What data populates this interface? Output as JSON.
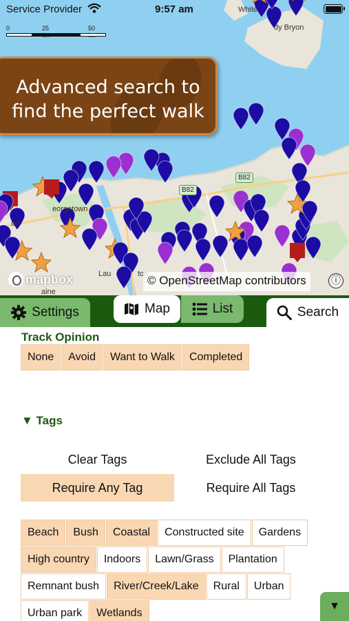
{
  "status_bar": {
    "carrier": "Service Provider",
    "time": "9:57 am",
    "wifi_icon": "wifi-icon",
    "battery_icon": "battery-icon"
  },
  "map": {
    "scale": {
      "labels": [
        "0",
        "25 km",
        "50 km"
      ]
    },
    "banner_line1": "Advanced search to",
    "banner_line2": "find the perfect walk",
    "place_labels": [
      "White",
      "dy Bryon",
      "eorgetown",
      "ort",
      "Lau",
      "ton",
      "aine"
    ],
    "road_badges": [
      "B82",
      "B82"
    ],
    "attribution": "© OpenStreetMap contributors",
    "mapbox_logo": "mapbox",
    "info_button": "ⓘ",
    "colors": {
      "water": "#8fd0f0",
      "land": "#e9e5da",
      "pin_blue": "#1c0ca3",
      "pin_purple": "#9a30d1",
      "pin_orange": "#f0a040"
    }
  },
  "tabs": {
    "settings": "Settings",
    "map": "Map",
    "list": "List",
    "search": "Search",
    "icons": {
      "settings": "gear-icon",
      "map": "map-icon",
      "list": "list-icon",
      "search": "magnifier-icon"
    }
  },
  "track_opinion": {
    "title": "Track Opinion",
    "options": [
      {
        "label": "None",
        "selected": true
      },
      {
        "label": "Avoid",
        "selected": true
      },
      {
        "label": "Want to Walk",
        "selected": true
      },
      {
        "label": "Completed",
        "selected": true
      }
    ]
  },
  "tags": {
    "title": "▼ Tags",
    "actions": {
      "clear": "Clear Tags",
      "exclude_all": "Exclude All Tags",
      "require_any": "Require Any Tag",
      "require_all": "Require All Tags"
    },
    "items": [
      {
        "label": "Beach",
        "selected": true
      },
      {
        "label": "Bush",
        "selected": true
      },
      {
        "label": "Coastal",
        "selected": true
      },
      {
        "label": "Constructed site",
        "selected": false
      },
      {
        "label": "Gardens",
        "selected": false
      },
      {
        "label": "High country",
        "selected": true
      },
      {
        "label": "Indoors",
        "selected": false
      },
      {
        "label": "Lawn/Grass",
        "selected": false
      },
      {
        "label": "Plantation",
        "selected": false
      },
      {
        "label": "Remnant bush",
        "selected": false
      },
      {
        "label": "River/Creek/Lake",
        "selected": true
      },
      {
        "label": "Rural",
        "selected": false
      },
      {
        "label": "Urban",
        "selected": false
      },
      {
        "label": "Urban park",
        "selected": false
      },
      {
        "label": "Wetlands",
        "selected": true
      }
    ]
  },
  "collapse_button": "▼",
  "colors": {
    "accent_green": "#1a5b10",
    "tab_green": "#7ab96e",
    "chip_selected": "#fad7b3",
    "chip_border": "#f0c9a1",
    "banner_brown": "#7b4414"
  }
}
